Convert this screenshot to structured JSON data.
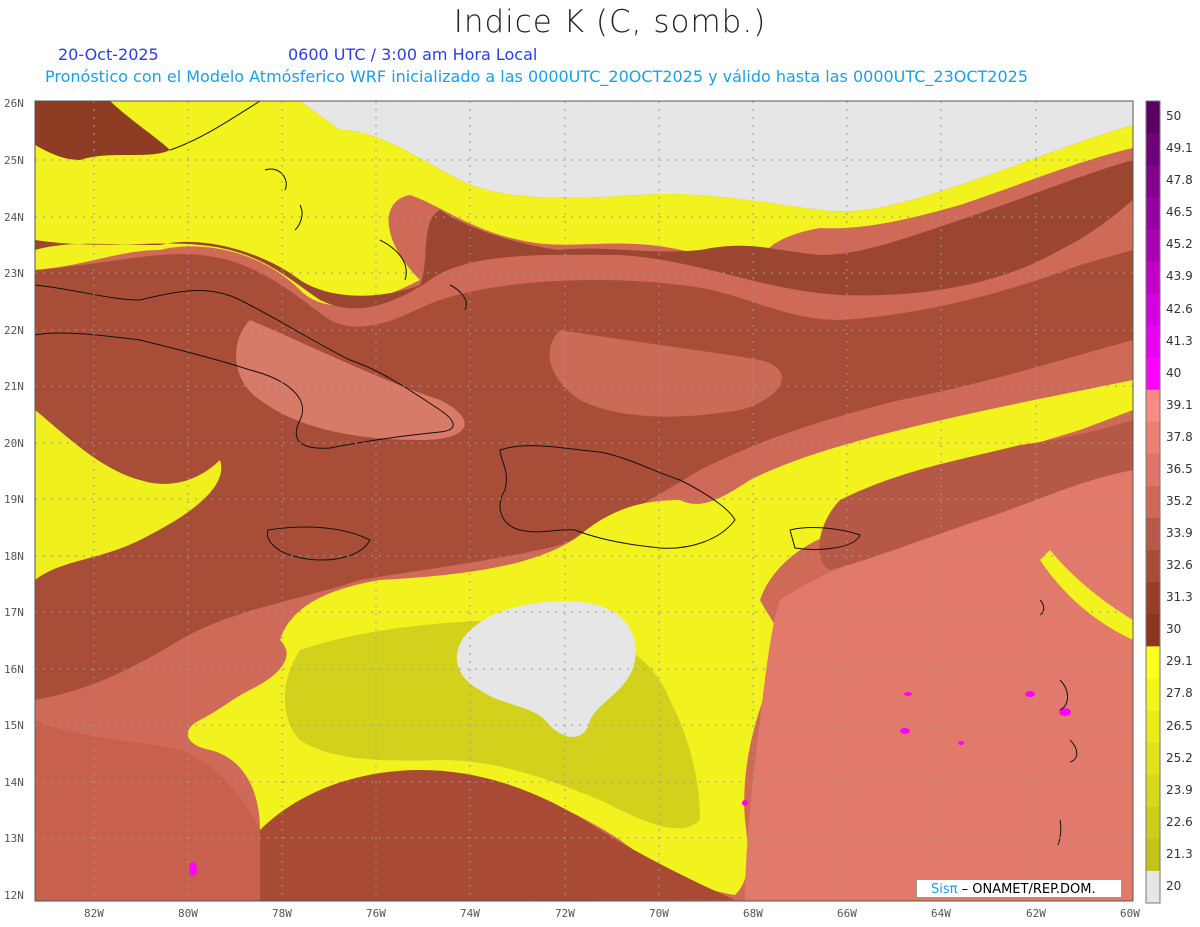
{
  "header": {
    "title": "Indice K (C, somb.)",
    "date": "20-Oct-2025",
    "valid_time": "0600 UTC / 3:00 am Hora Local",
    "model_line": "Pronóstico con el Modelo Atmósferico WRF inicializado a las 0000UTC_20OCT2025 y válido hasta las  0000UTC_23OCT2025"
  },
  "map": {
    "lon_labels": [
      "82W",
      "80W",
      "78W",
      "76W",
      "74W",
      "72W",
      "70W",
      "68W",
      "66W",
      "64W",
      "62W",
      "60W"
    ],
    "lat_labels": [
      "26N",
      "25N",
      "24N",
      "23N",
      "22N",
      "21N",
      "20N",
      "19N",
      "18N",
      "17N",
      "16N",
      "15N",
      "14N",
      "13N",
      "12N"
    ],
    "lon_range": [
      -83.2,
      -60
    ],
    "lat_range": [
      11.9,
      26.05
    ],
    "colors": {
      "missing": "#e6e6e6",
      "low_yellow": "#f5f51e",
      "olive": "#c8c81e",
      "salmon": "#d86e5a",
      "light_salmon": "#ee7e72",
      "brown": "#a04a32",
      "dark_brown": "#8c3a22",
      "magenta": "#ff00ff"
    }
  },
  "colorbar": {
    "labels": [
      "50",
      "49.1",
      "47.8",
      "46.5",
      "45.2",
      "43.9",
      "42.6",
      "41.3",
      "40",
      "39.1",
      "37.8",
      "36.5",
      "35.2",
      "33.9",
      "32.6",
      "31.3",
      "30",
      "29.1",
      "27.8",
      "26.5",
      "25.2",
      "23.9",
      "22.6",
      "21.3",
      "20"
    ],
    "colors": [
      "#5a0060",
      "#6e0078",
      "#82008c",
      "#9600a0",
      "#aa00b4",
      "#be00c8",
      "#d200dc",
      "#e600f0",
      "#ff00ff",
      "#f88c82",
      "#ee7e72",
      "#e07468",
      "#d06858",
      "#b85848",
      "#a84c38",
      "#983e28",
      "#8c3620",
      "#ffff22",
      "#f5f51e",
      "#ebeb1c",
      "#e1e11c",
      "#d7d71c",
      "#cdcd1c",
      "#c3c31a",
      "#e6e6e6"
    ]
  },
  "credit": {
    "brand": "Sisπ",
    "text": "– ONAMET/REP.DOM."
  }
}
